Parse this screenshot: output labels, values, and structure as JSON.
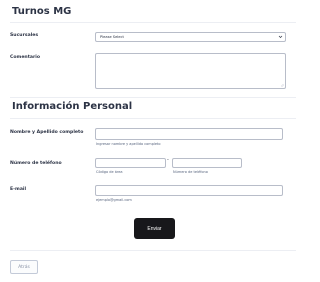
{
  "header": {
    "title": "Turnos MG"
  },
  "sucursales": {
    "label": "Sucursales",
    "value": "Please Select"
  },
  "comentario": {
    "label": "Comentario",
    "value": ""
  },
  "section": {
    "title": "Información Personal"
  },
  "nombre": {
    "label": "Nombre y Apellido completo",
    "value": "",
    "sublabel": "Ingresar nombre y apellido completo"
  },
  "telefono": {
    "label": "Número de teléfono",
    "area_value": "",
    "area_sublabel": "Código de área",
    "number_value": "",
    "number_sublabel": "Número de teléfono",
    "separator": "-"
  },
  "email": {
    "label": "E-mail",
    "value": "",
    "sublabel": "ejemplo@gmail.com"
  },
  "actions": {
    "submit_label": "Enviar",
    "back_label": "Atrás"
  },
  "icons": {
    "select_chevron": "chevron-down-icon"
  }
}
